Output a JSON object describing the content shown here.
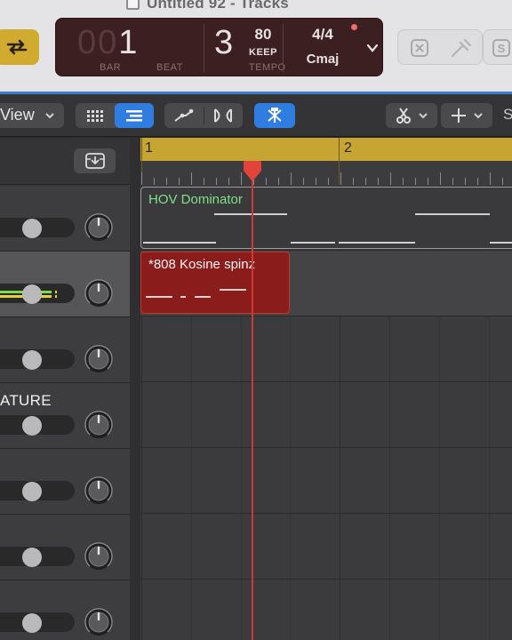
{
  "window": {
    "title": "Untitled 92 - Tracks"
  },
  "lcd": {
    "bar_dim": "00",
    "bar_lit": "1",
    "beat": "3",
    "bar_label": "BAR",
    "beat_label": "BEAT",
    "tempo": "80",
    "tempo_mode": "KEEP",
    "tempo_label": "TEMPO",
    "time_signature": "4/4",
    "key": "Cmaj"
  },
  "toolbar": {
    "view_label": "View"
  },
  "ruler": {
    "bars": [
      "1",
      "2"
    ]
  },
  "tracks": [
    {
      "name": "",
      "selected": false
    },
    {
      "name": "",
      "selected": true
    },
    {
      "name": "",
      "selected": false
    },
    {
      "name": "ATURE",
      "selected": false
    },
    {
      "name": "",
      "selected": false
    },
    {
      "name": "",
      "selected": false
    },
    {
      "name": "",
      "selected": false
    }
  ],
  "regions": [
    {
      "name": "HOV Dominator",
      "track": 0,
      "color": "#3a3a3c",
      "text_color": "#7fe08a"
    },
    {
      "name": "*808 Kosine spinz",
      "track": 1,
      "color": "#8b1c1c",
      "text_color": "#f2f2f2"
    }
  ],
  "colors": {
    "accent_blue": "#2f7de1",
    "cycle_yellow": "#d1ab2f",
    "ruler_gold": "#c6a532",
    "playhead_red": "#d13a33",
    "lcd_bg": "#3b1f21"
  }
}
